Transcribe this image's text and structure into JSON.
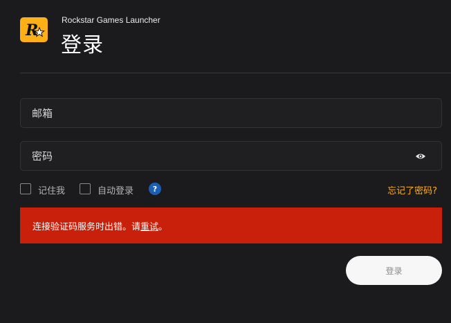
{
  "app": {
    "logo_letter": "R",
    "title": "Rockstar Games Launcher"
  },
  "page": {
    "title": "登录"
  },
  "form": {
    "email": {
      "placeholder": "邮箱",
      "value": ""
    },
    "password": {
      "placeholder": "密码",
      "value": ""
    },
    "remember_me": {
      "label": "记住我",
      "checked": false
    },
    "auto_login": {
      "label": "自动登录",
      "checked": false
    },
    "help_icon": "?",
    "forgot_password": "忘记了密码?"
  },
  "error": {
    "message_prefix": "连接验证码服务时出错。请",
    "retry_link": "重试",
    "message_suffix": "。"
  },
  "submit": {
    "label": "登录"
  },
  "colors": {
    "background": "#1b1b1d",
    "accent": "#fcaf17",
    "error": "#c8200b",
    "help": "#1a5fb4",
    "button": "#f7f7f7"
  }
}
